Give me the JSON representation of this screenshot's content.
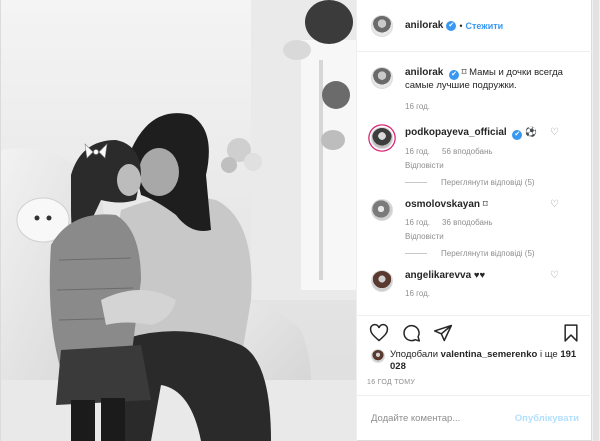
{
  "post": {
    "author": "anilorak",
    "follow_label": "Стежити",
    "verified_symbol": "✔",
    "separator": "•",
    "more_symbol": "•••"
  },
  "caption": {
    "author": "anilorak",
    "text_prefix": "⌑ ",
    "text": "Мамы и дочки всегда самые лучшие подружки.",
    "time": "16 год."
  },
  "comments": [
    {
      "author": "podkopayeva_official",
      "text": "⚽",
      "time": "16 год.",
      "likes": "56 вподобань",
      "reply_label": "Відповісти",
      "view_replies": "Переглянути відповіді (5)"
    },
    {
      "author": "osmolovskayan",
      "text": "⌑",
      "time": "16 год.",
      "likes": "36 вподобань",
      "reply_label": "Відповісти",
      "view_replies": "Переглянути відповіді (5)"
    },
    {
      "author": "angelikarevva",
      "text": "♥♥",
      "time": "16 год."
    }
  ],
  "likes": {
    "prefix": "Уподобали",
    "user": "valentina_semerenko",
    "middle": "і ще",
    "count": "191 028"
  },
  "post_time": "16 ГОД ТОМУ",
  "add_comment": {
    "placeholder": "Додайте коментар...",
    "publish_label": "Опублікувати"
  },
  "icons": {
    "like": "heart-icon",
    "comment": "comment-icon",
    "share": "share-icon",
    "save": "bookmark-icon"
  },
  "colors": {
    "accent": "#3897f0",
    "publish_disabled": "#b2dffc",
    "muted": "#8e8e8e"
  }
}
